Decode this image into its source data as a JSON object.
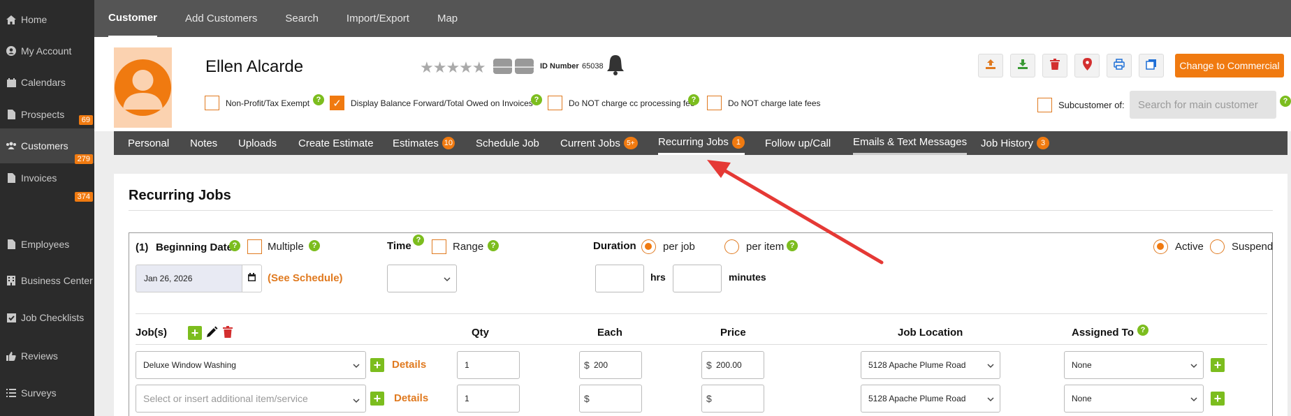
{
  "sidebar": {
    "items": [
      {
        "label": "Home",
        "icon": "home-icon",
        "badge": ""
      },
      {
        "label": "My Account",
        "icon": "user-circle-icon",
        "badge": ""
      },
      {
        "label": "Calendars",
        "icon": "calendar-icon",
        "badge": ""
      },
      {
        "label": "Prospects",
        "icon": "document-icon",
        "badge": "69"
      },
      {
        "label": "Customers",
        "icon": "users-icon",
        "badge": "279"
      },
      {
        "label": "Invoices",
        "icon": "document-icon",
        "badge": "374"
      },
      {
        "label": "Employees",
        "icon": "document-icon",
        "badge": ""
      },
      {
        "label": "Business Center",
        "icon": "building-icon",
        "badge": ""
      },
      {
        "label": "Job Checklists",
        "icon": "checkbox-icon",
        "badge": ""
      },
      {
        "label": "Reviews",
        "icon": "thumbs-up-icon",
        "badge": ""
      },
      {
        "label": "Surveys",
        "icon": "list-icon",
        "badge": ""
      }
    ]
  },
  "topnav": {
    "items": [
      "Customer",
      "Add Customers",
      "Search",
      "Import/Export",
      "Map"
    ],
    "active": "Customer"
  },
  "customer": {
    "name": "Ellen Alcarde",
    "id_label": "ID Number",
    "id_value": "65038",
    "stars": "★★★★★",
    "rating": 0
  },
  "toolbar": {
    "change_commercial_label": "Change to Commercial",
    "buttons": [
      "upload-icon",
      "download-icon",
      "trash-icon",
      "map-pin-icon",
      "print-icon",
      "copy-icon"
    ]
  },
  "options": {
    "non_profit": "Non-Profit/Tax Exempt",
    "display_balance": "Display Balance Forward/Total Owed on Invoices",
    "no_cc_fee": "Do NOT charge cc processing fee",
    "no_late_fees": "Do NOT charge late fees",
    "subcustomer_label": "Subcustomer of:",
    "subcustomer_placeholder": "Search for main customer"
  },
  "tabs": {
    "personal": "Personal",
    "notes": "Notes",
    "uploads": "Uploads",
    "create_estimate": "Create Estimate",
    "estimates": "Estimates",
    "estimates_badge": "10",
    "schedule_job": "Schedule Job",
    "current_jobs": "Current Jobs",
    "current_jobs_badge": "5+",
    "recurring_jobs": "Recurring Jobs",
    "recurring_jobs_badge": "1",
    "follow_up": "Follow up/Call",
    "emails": "Emails & Text Messages",
    "job_history": "Job History",
    "job_history_badge": "3"
  },
  "recurring": {
    "title": "Recurring Jobs",
    "index": "(1)",
    "beginning_date_label": "Beginning Date",
    "multiple_label": "Multiple",
    "time_label": "Time",
    "range_label": "Range",
    "duration_label": "Duration",
    "per_job_label": "per job",
    "per_item_label": "per item",
    "active_label": "Active",
    "suspend_label": "Suspend",
    "beginning_date_value": "Jan 26, 2026",
    "see_schedule": "(See Schedule)",
    "time_value": "",
    "hrs_label": "hrs",
    "minutes_label": "minutes",
    "hrs_value": "",
    "minutes_value": ""
  },
  "jobs_table": {
    "headers": {
      "jobs": "Job(s)",
      "qty": "Qty",
      "each": "Each",
      "price": "Price",
      "location": "Job Location",
      "assigned": "Assigned To"
    },
    "details_label": "Details",
    "currency": "$",
    "rows": [
      {
        "item": "Deluxe Window Washing",
        "qty": "1",
        "each": "200",
        "price": "200.00",
        "location": "5128 Apache Plume Road",
        "assigned": "None"
      },
      {
        "item": "",
        "qty": "1",
        "each": "",
        "price": "",
        "location": "5128 Apache Plume Road",
        "assigned": "None"
      }
    ],
    "item_placeholder": "Select or insert additional item/service"
  },
  "colors": {
    "accent": "#f07a10",
    "help_green": "#7cbd1e",
    "sidebar_bg": "#2b2b2b",
    "arrow_red": "#e53935"
  }
}
